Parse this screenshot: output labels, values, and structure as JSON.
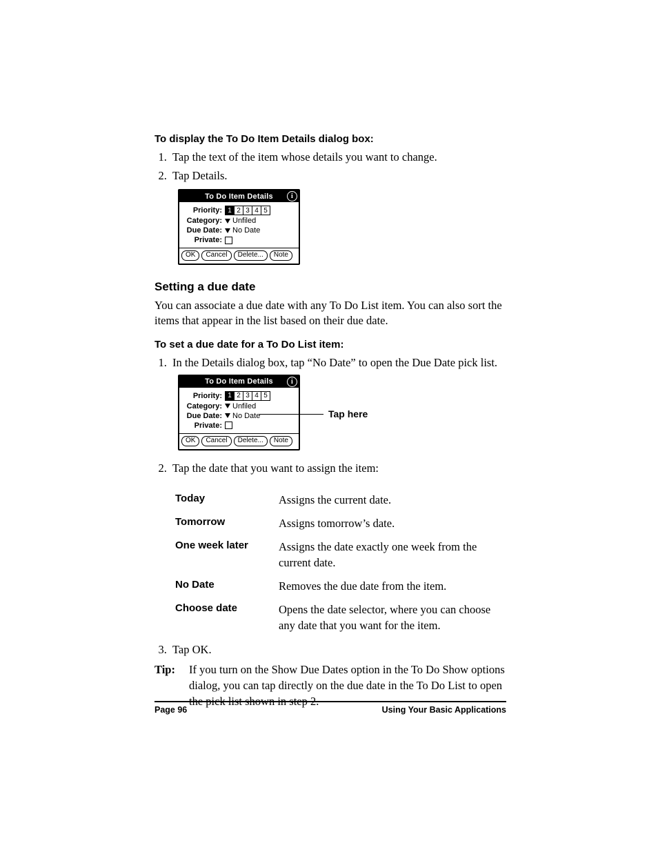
{
  "heading1": "To display the To Do Item Details dialog box:",
  "steps1": [
    "Tap the text of the item whose details you want to change.",
    "Tap Details."
  ],
  "dialog": {
    "title": "To Do Item Details",
    "priority_label": "Priority:",
    "priority_values": [
      "1",
      "2",
      "3",
      "4",
      "5"
    ],
    "category_label": "Category:",
    "category_value": "Unfiled",
    "due_label": "Due Date:",
    "due_value": "No Date",
    "private_label": "Private:",
    "buttons": [
      "OK",
      "Cancel",
      "Delete...",
      "Note"
    ]
  },
  "section_hd": "Setting a due date",
  "section_intro": "You can associate a due date with any To Do List item. You can also sort the items that appear in the list based on their due date.",
  "heading2": "To set a due date for a To Do List item:",
  "step2_1": "In the Details dialog box, tap “No Date” to open the Due Date pick list.",
  "callout": "Tap here",
  "step2_2": "Tap the date that you want to assign the item:",
  "options": [
    {
      "term": "Today",
      "desc": "Assigns the current date."
    },
    {
      "term": "Tomorrow",
      "desc": "Assigns tomorrow’s date."
    },
    {
      "term": "One week later",
      "desc": "Assigns the date exactly one week from the current date."
    },
    {
      "term": "No Date",
      "desc": "Removes the due date from the item."
    },
    {
      "term": "Choose date",
      "desc": "Opens the date selector, where you can choose any date that you want for the item."
    }
  ],
  "step2_3": "Tap OK.",
  "tip_label": "Tip:",
  "tip_body": "If you turn on the Show Due Dates option in the To Do Show options dialog, you can tap directly on the due date in the To Do List to open the pick list shown in step 2.",
  "footer_left": "Page 96",
  "footer_right": "Using Your Basic Applications"
}
